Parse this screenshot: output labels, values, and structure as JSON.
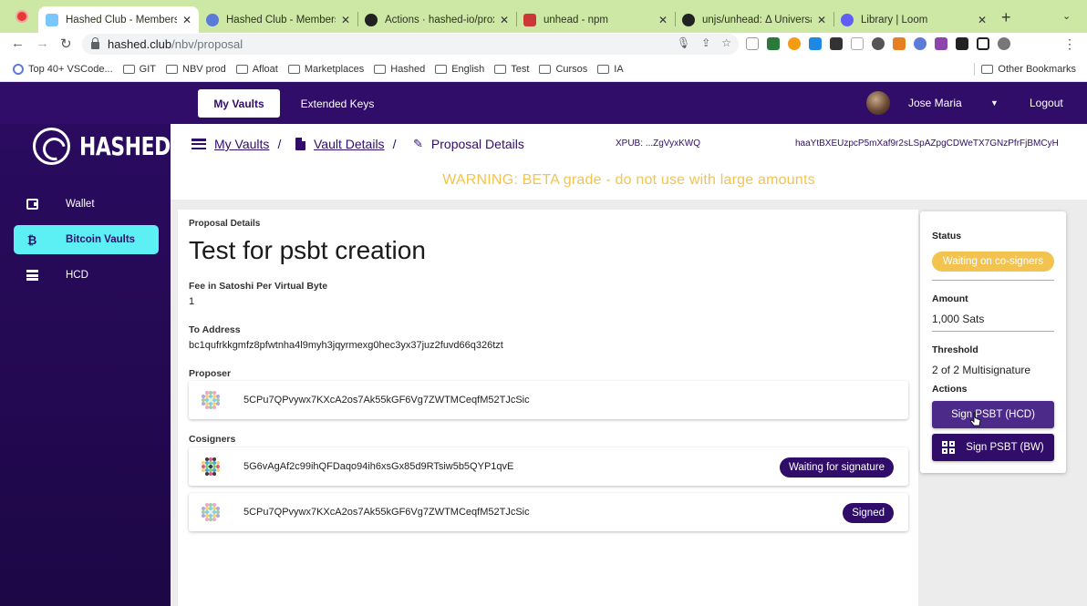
{
  "browser": {
    "tabs": [
      {
        "title": "Hashed Club - Members C",
        "icon": "hashed-favicon",
        "color": "#7ac6ff"
      },
      {
        "title": "Hashed Club - Members C",
        "icon": "gear-favicon",
        "color": "#5a7bd8"
      },
      {
        "title": "Actions · hashed-io/proxy",
        "icon": "github-icon",
        "color": "#222222"
      },
      {
        "title": "unhead - npm",
        "icon": "npm-icon",
        "color": "#cb3837"
      },
      {
        "title": "unjs/unhead: Δ Universal",
        "icon": "github-icon",
        "color": "#222222"
      },
      {
        "title": "Library | Loom",
        "icon": "loom-icon",
        "color": "#625df5"
      }
    ],
    "url_host": "hashed.club",
    "url_path": "/nbv/proposal",
    "bookmarks": [
      "Top 40+ VSCode...",
      "GIT",
      "NBV prod",
      "Afloat",
      "Marketplaces",
      "Hashed",
      "English",
      "Test",
      "Cursos",
      "IA"
    ],
    "other_bookmarks": "Other Bookmarks"
  },
  "header": {
    "tabs": [
      "My Vaults",
      "Extended Keys"
    ],
    "user_name": "Jose Maria",
    "logout": "Logout"
  },
  "sidebar": {
    "logo_text": "HASHED",
    "items": [
      {
        "label": "Wallet",
        "icon": "wallet-icon"
      },
      {
        "label": "Bitcoin Vaults",
        "icon": "bitcoin-icon"
      },
      {
        "label": "HCD",
        "icon": "storage-icon"
      }
    ]
  },
  "breadcrumb": {
    "my_vaults": "My Vaults",
    "vault_details": "Vault Details",
    "proposal_details": "Proposal Details",
    "separator": "/",
    "xpub": "XPUB: ...ZgVyxKWQ",
    "id": "haaYtBXEUzpcP5mXaf9r2sLSpAZpgCDWeTX7GNzPfrFjBMCyH"
  },
  "warning": "WARNING: BETA grade - do not use with large amounts",
  "proposal": {
    "section_label": "Proposal Details",
    "title": "Test for psbt creation",
    "fee_label": "Fee in Satoshi Per Virtual Byte",
    "fee_value": "1",
    "to_address_label": "To Address",
    "to_address": "bc1qufrkkgmfz8pfwtnha4l9myh3jqyrmexg0hec3yx37juz2fuvd66q326tzt",
    "proposer_label": "Proposer",
    "proposer": "5CPu7QPvywx7KXcA2os7Ak55kGF6Vg7ZWTMCeqfM52TJcSic",
    "cosigners_label": "Cosigners",
    "cosigners": [
      {
        "address": "5G6vAgAf2c99ihQFDaqo94ih6xsGx85d9RTsiw5b5QYP1qvE",
        "status": "Waiting for signature"
      },
      {
        "address": "5CPu7QPvywx7KXcA2os7Ak55kGF6Vg7ZWTMCeqfM52TJcSic",
        "status": "Signed"
      }
    ]
  },
  "status_panel": {
    "status_label": "Status",
    "status_value": "Waiting on co-signers",
    "amount_label": "Amount",
    "amount_value": "1,000 Sats",
    "threshold_label": "Threshold",
    "threshold_value": "2 of 2 Multisignature",
    "actions_label": "Actions",
    "sign_hcd": "Sign PSBT (HCD)",
    "sign_bw": "Sign PSBT (BW)"
  },
  "colors": {
    "brand_purple": "#2f0d69",
    "accent_cyan": "#5cf0f5",
    "warning_yellow": "#f3c350",
    "chrome_green": "#cde7a4"
  }
}
